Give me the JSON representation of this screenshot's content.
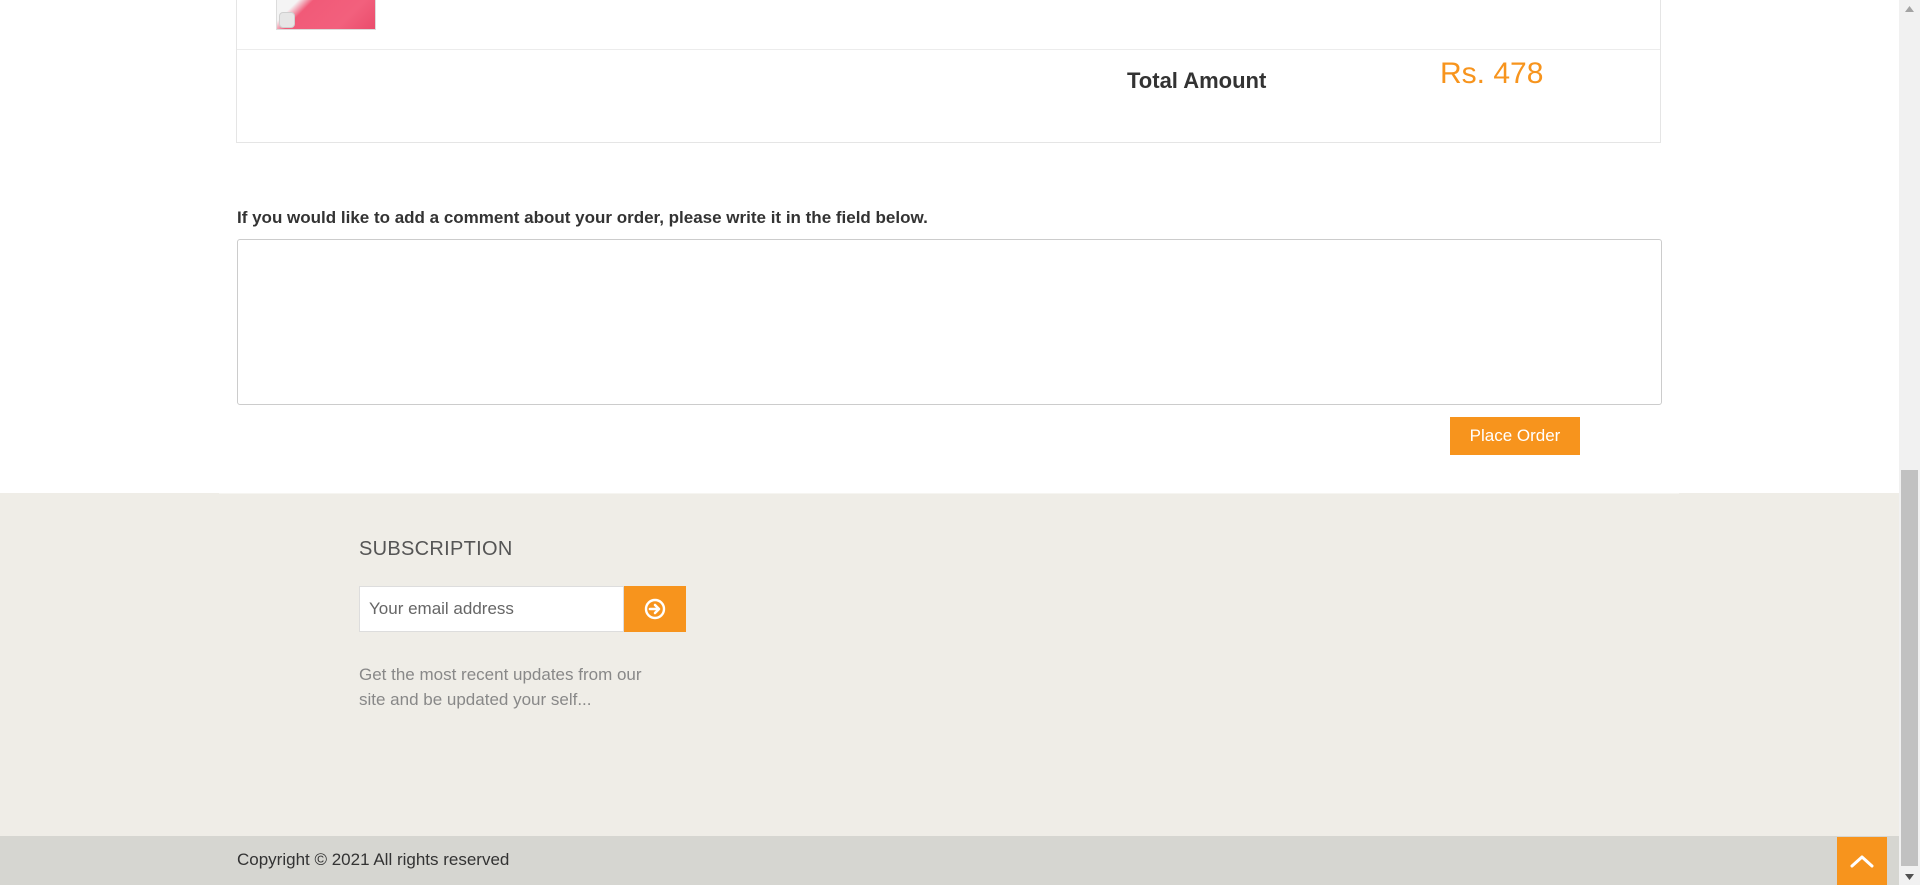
{
  "order": {
    "total_label": "Total Amount",
    "total_value": "Rs. 478"
  },
  "comment": {
    "label": "If you would like to add a comment about your order, please write it in the field below.",
    "value": "",
    "placeholder": ""
  },
  "place_order_label": "Place Order",
  "subscription": {
    "heading": "SUBSCRIPTION",
    "email_placeholder": "Your email address",
    "submit_icon": "arrow-circle-right-icon",
    "description": "Get the most recent updates from our site and be updated your self..."
  },
  "footer": {
    "copyright": "Copyright © 2021 All rights reserved",
    "scroll_top_icon": "chevron-up-icon"
  },
  "colors": {
    "accent": "#f7941d",
    "footer_bg": "#efede7",
    "copyright_bg": "#d6d6d1"
  }
}
